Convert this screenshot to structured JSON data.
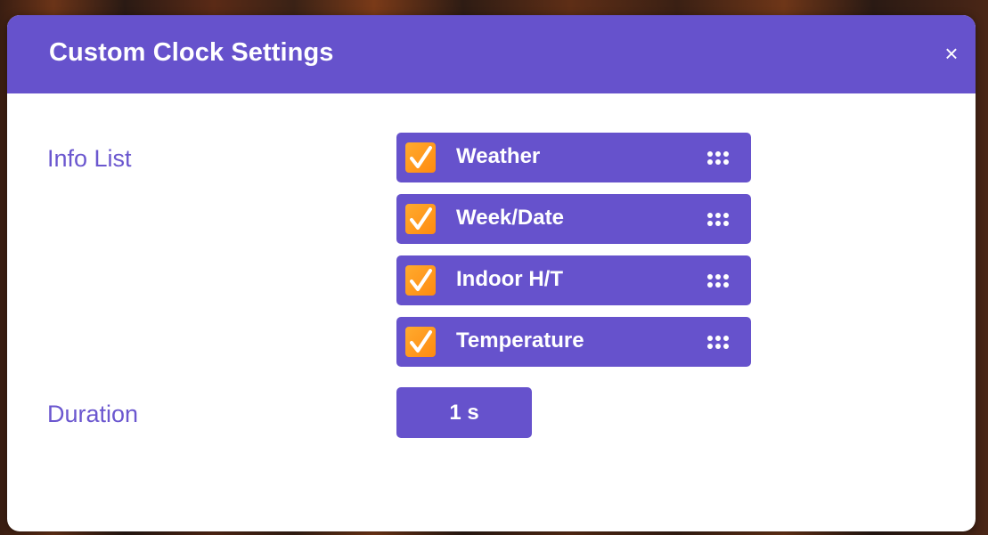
{
  "dialog": {
    "title": "Custom Clock Settings",
    "close_symbol": "×"
  },
  "info_list": {
    "label": "Info List",
    "items": [
      {
        "label": "Weather",
        "checked": true
      },
      {
        "label": "Week/Date",
        "checked": true
      },
      {
        "label": "Indoor H/T",
        "checked": true
      },
      {
        "label": "Temperature",
        "checked": true
      }
    ]
  },
  "duration": {
    "label": "Duration",
    "value": "1 s"
  },
  "colors": {
    "accent": "#6652cc",
    "label_text": "#6b57cf",
    "checkbox": "#ff9a1e"
  },
  "icons": {
    "close": "close-icon",
    "check": "checkmark-icon",
    "drag": "drag-handle-icon"
  }
}
